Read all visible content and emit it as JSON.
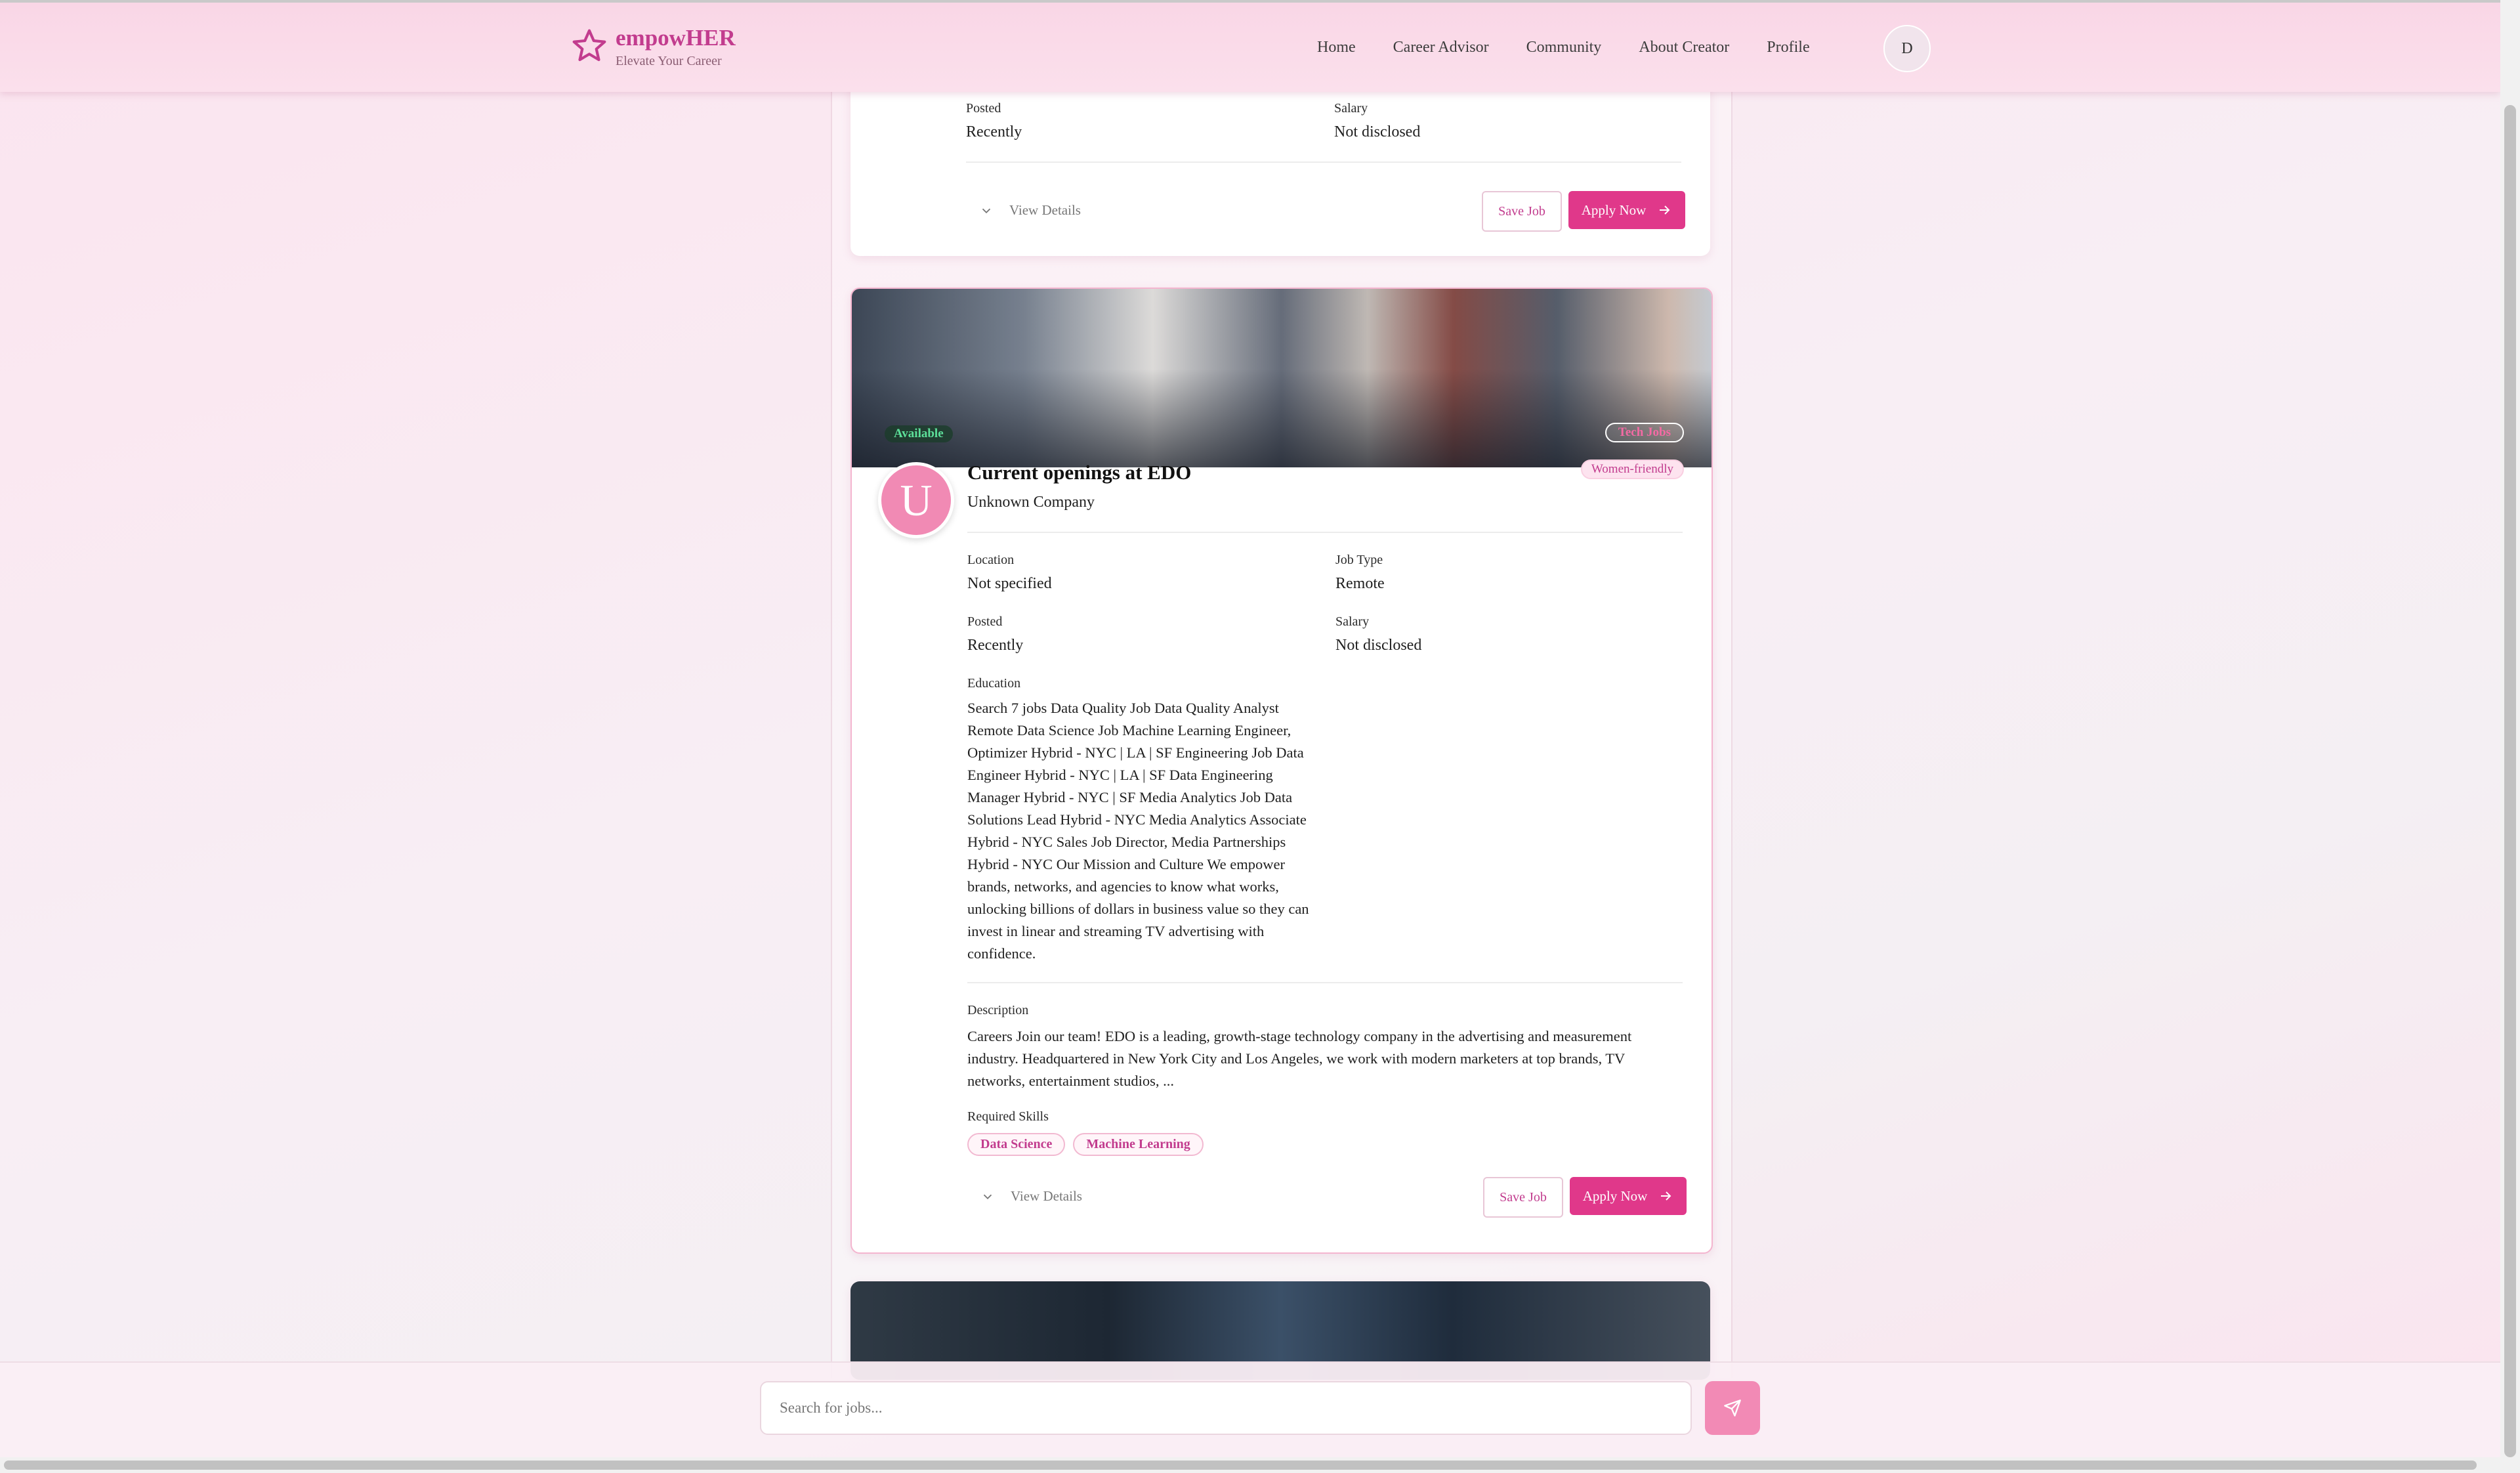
{
  "header": {
    "brand": "empowHER",
    "tagline": "Elevate Your Career",
    "nav": [
      "Home",
      "Career Advisor",
      "Community",
      "About Creator",
      "Profile"
    ],
    "avatar_initial": "D"
  },
  "card_top": {
    "posted_label": "Posted",
    "posted_value": "Recently",
    "salary_label": "Salary",
    "salary_value": "Not disclosed",
    "view_details": "View Details",
    "save_label": "Save Job",
    "apply_label": "Apply Now"
  },
  "card_main": {
    "status_badge": "Available",
    "category_badge": "Tech Jobs",
    "women_badge": "Women-friendly",
    "avatar_initial": "U",
    "title": "Current openings at EDO",
    "company": "Unknown Company",
    "location_label": "Location",
    "location_value": "Not specified",
    "job_type_label": "Job Type",
    "job_type_value": "Remote",
    "posted_label": "Posted",
    "posted_value": "Recently",
    "salary_label": "Salary",
    "salary_value": "Not disclosed",
    "education_label": "Education",
    "education_text": "Search 7 jobs Data Quality Job Data Quality Analyst Remote Data Science Job Machine Learning Engineer, Optimizer Hybrid - NYC | LA | SF Engineering Job Data Engineer Hybrid - NYC | LA | SF Data Engineering Manager Hybrid - NYC | SF Media Analytics Job Data Solutions Lead Hybrid - NYC Media Analytics Associate Hybrid - NYC Sales Job Director, Media Partnerships Hybrid - NYC Our Mission and Culture We empower brands, networks, and agencies to know what works, unlocking billions of dollars in business value so they can invest in linear and streaming TV advertising with confidence.",
    "description_label": "Description",
    "description_text": "Careers Join our team! EDO is a leading, growth-stage technology company in the advertising and measurement industry. Headquartered in New York City and Los Angeles, we work with modern marketers at top brands, TV networks, entertainment studios, ...",
    "skills_label": "Required Skills",
    "skills": [
      "Data Science",
      "Machine Learning"
    ],
    "view_details": "View Details",
    "save_label": "Save Job",
    "apply_label": "Apply Now"
  },
  "search": {
    "placeholder": "Search for jobs..."
  },
  "colors": {
    "accent": "#e0388a",
    "brand": "#c23c8e",
    "available": "#5de09a"
  }
}
